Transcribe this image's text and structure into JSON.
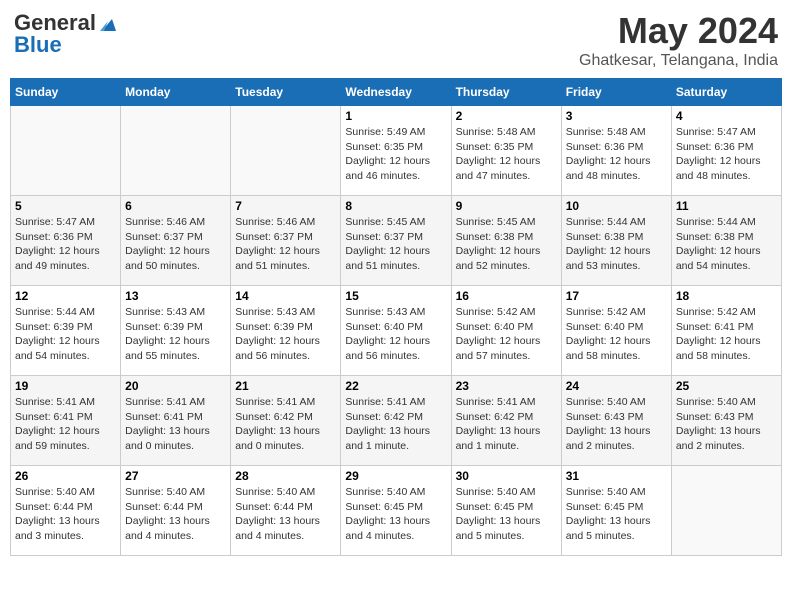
{
  "header": {
    "logo_general": "General",
    "logo_blue": "Blue",
    "title": "May 2024",
    "subtitle": "Ghatkesar, Telangana, India"
  },
  "days_of_week": [
    "Sunday",
    "Monday",
    "Tuesday",
    "Wednesday",
    "Thursday",
    "Friday",
    "Saturday"
  ],
  "weeks": [
    [
      {
        "day": "",
        "info": ""
      },
      {
        "day": "",
        "info": ""
      },
      {
        "day": "",
        "info": ""
      },
      {
        "day": "1",
        "info": "Sunrise: 5:49 AM\nSunset: 6:35 PM\nDaylight: 12 hours\nand 46 minutes."
      },
      {
        "day": "2",
        "info": "Sunrise: 5:48 AM\nSunset: 6:35 PM\nDaylight: 12 hours\nand 47 minutes."
      },
      {
        "day": "3",
        "info": "Sunrise: 5:48 AM\nSunset: 6:36 PM\nDaylight: 12 hours\nand 48 minutes."
      },
      {
        "day": "4",
        "info": "Sunrise: 5:47 AM\nSunset: 6:36 PM\nDaylight: 12 hours\nand 48 minutes."
      }
    ],
    [
      {
        "day": "5",
        "info": "Sunrise: 5:47 AM\nSunset: 6:36 PM\nDaylight: 12 hours\nand 49 minutes."
      },
      {
        "day": "6",
        "info": "Sunrise: 5:46 AM\nSunset: 6:37 PM\nDaylight: 12 hours\nand 50 minutes."
      },
      {
        "day": "7",
        "info": "Sunrise: 5:46 AM\nSunset: 6:37 PM\nDaylight: 12 hours\nand 51 minutes."
      },
      {
        "day": "8",
        "info": "Sunrise: 5:45 AM\nSunset: 6:37 PM\nDaylight: 12 hours\nand 51 minutes."
      },
      {
        "day": "9",
        "info": "Sunrise: 5:45 AM\nSunset: 6:38 PM\nDaylight: 12 hours\nand 52 minutes."
      },
      {
        "day": "10",
        "info": "Sunrise: 5:44 AM\nSunset: 6:38 PM\nDaylight: 12 hours\nand 53 minutes."
      },
      {
        "day": "11",
        "info": "Sunrise: 5:44 AM\nSunset: 6:38 PM\nDaylight: 12 hours\nand 54 minutes."
      }
    ],
    [
      {
        "day": "12",
        "info": "Sunrise: 5:44 AM\nSunset: 6:39 PM\nDaylight: 12 hours\nand 54 minutes."
      },
      {
        "day": "13",
        "info": "Sunrise: 5:43 AM\nSunset: 6:39 PM\nDaylight: 12 hours\nand 55 minutes."
      },
      {
        "day": "14",
        "info": "Sunrise: 5:43 AM\nSunset: 6:39 PM\nDaylight: 12 hours\nand 56 minutes."
      },
      {
        "day": "15",
        "info": "Sunrise: 5:43 AM\nSunset: 6:40 PM\nDaylight: 12 hours\nand 56 minutes."
      },
      {
        "day": "16",
        "info": "Sunrise: 5:42 AM\nSunset: 6:40 PM\nDaylight: 12 hours\nand 57 minutes."
      },
      {
        "day": "17",
        "info": "Sunrise: 5:42 AM\nSunset: 6:40 PM\nDaylight: 12 hours\nand 58 minutes."
      },
      {
        "day": "18",
        "info": "Sunrise: 5:42 AM\nSunset: 6:41 PM\nDaylight: 12 hours\nand 58 minutes."
      }
    ],
    [
      {
        "day": "19",
        "info": "Sunrise: 5:41 AM\nSunset: 6:41 PM\nDaylight: 12 hours\nand 59 minutes."
      },
      {
        "day": "20",
        "info": "Sunrise: 5:41 AM\nSunset: 6:41 PM\nDaylight: 13 hours\nand 0 minutes."
      },
      {
        "day": "21",
        "info": "Sunrise: 5:41 AM\nSunset: 6:42 PM\nDaylight: 13 hours\nand 0 minutes."
      },
      {
        "day": "22",
        "info": "Sunrise: 5:41 AM\nSunset: 6:42 PM\nDaylight: 13 hours\nand 1 minute."
      },
      {
        "day": "23",
        "info": "Sunrise: 5:41 AM\nSunset: 6:42 PM\nDaylight: 13 hours\nand 1 minute."
      },
      {
        "day": "24",
        "info": "Sunrise: 5:40 AM\nSunset: 6:43 PM\nDaylight: 13 hours\nand 2 minutes."
      },
      {
        "day": "25",
        "info": "Sunrise: 5:40 AM\nSunset: 6:43 PM\nDaylight: 13 hours\nand 2 minutes."
      }
    ],
    [
      {
        "day": "26",
        "info": "Sunrise: 5:40 AM\nSunset: 6:44 PM\nDaylight: 13 hours\nand 3 minutes."
      },
      {
        "day": "27",
        "info": "Sunrise: 5:40 AM\nSunset: 6:44 PM\nDaylight: 13 hours\nand 4 minutes."
      },
      {
        "day": "28",
        "info": "Sunrise: 5:40 AM\nSunset: 6:44 PM\nDaylight: 13 hours\nand 4 minutes."
      },
      {
        "day": "29",
        "info": "Sunrise: 5:40 AM\nSunset: 6:45 PM\nDaylight: 13 hours\nand 4 minutes."
      },
      {
        "day": "30",
        "info": "Sunrise: 5:40 AM\nSunset: 6:45 PM\nDaylight: 13 hours\nand 5 minutes."
      },
      {
        "day": "31",
        "info": "Sunrise: 5:40 AM\nSunset: 6:45 PM\nDaylight: 13 hours\nand 5 minutes."
      },
      {
        "day": "",
        "info": ""
      }
    ]
  ]
}
